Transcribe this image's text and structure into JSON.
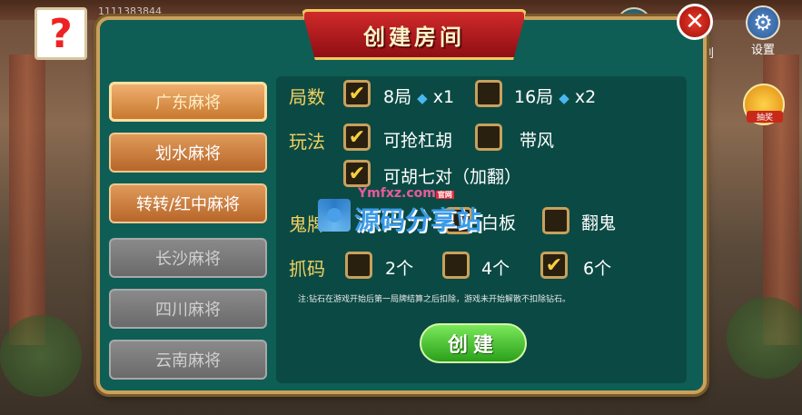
{
  "header": {
    "uid": "1111383844",
    "settings_label": "设置",
    "side_label": "创",
    "lucky_label": "抽奖"
  },
  "dialog": {
    "title": "创建房间",
    "close": "✕",
    "tabs": [
      {
        "label": "广东麻将",
        "state": "active"
      },
      {
        "label": "划水麻将",
        "state": "enabled"
      },
      {
        "label": "转转/红中麻将",
        "state": "enabled"
      },
      {
        "label": "长沙麻将",
        "state": "disabled"
      },
      {
        "label": "四川麻将",
        "state": "disabled"
      },
      {
        "label": "云南麻将",
        "state": "disabled"
      }
    ],
    "rounds": {
      "label": "局数",
      "options": [
        {
          "text": "8局",
          "cost": "x1",
          "checked": true
        },
        {
          "text": "16局",
          "cost": "x2",
          "checked": false
        }
      ]
    },
    "rules": {
      "label": "玩法",
      "options": [
        {
          "text": "可抢杠胡",
          "checked": true
        },
        {
          "text": "带风",
          "checked": false
        },
        {
          "text": "可胡七对（加翻）",
          "checked": true
        }
      ]
    },
    "ghost": {
      "label": "鬼牌",
      "options": [
        {
          "text": "白板",
          "checked": false
        },
        {
          "text": "翻鬼",
          "checked": false
        }
      ]
    },
    "horse": {
      "label": "抓码",
      "options": [
        {
          "text": "2个",
          "checked": false
        },
        {
          "text": "4个",
          "checked": false
        },
        {
          "text": "6个",
          "checked": true
        }
      ]
    },
    "note": "注:钻石在游戏开始后第一局牌结算之后扣除，游戏未开始解散不扣除钻石。",
    "create_label": "创建"
  },
  "watermark": {
    "url": "Ymfxz.com",
    "tag": "官网",
    "name": "源码分享站"
  },
  "colors": {
    "panel": "#0f5e55",
    "label": "#f2d060",
    "accent": "#c9a15c"
  }
}
